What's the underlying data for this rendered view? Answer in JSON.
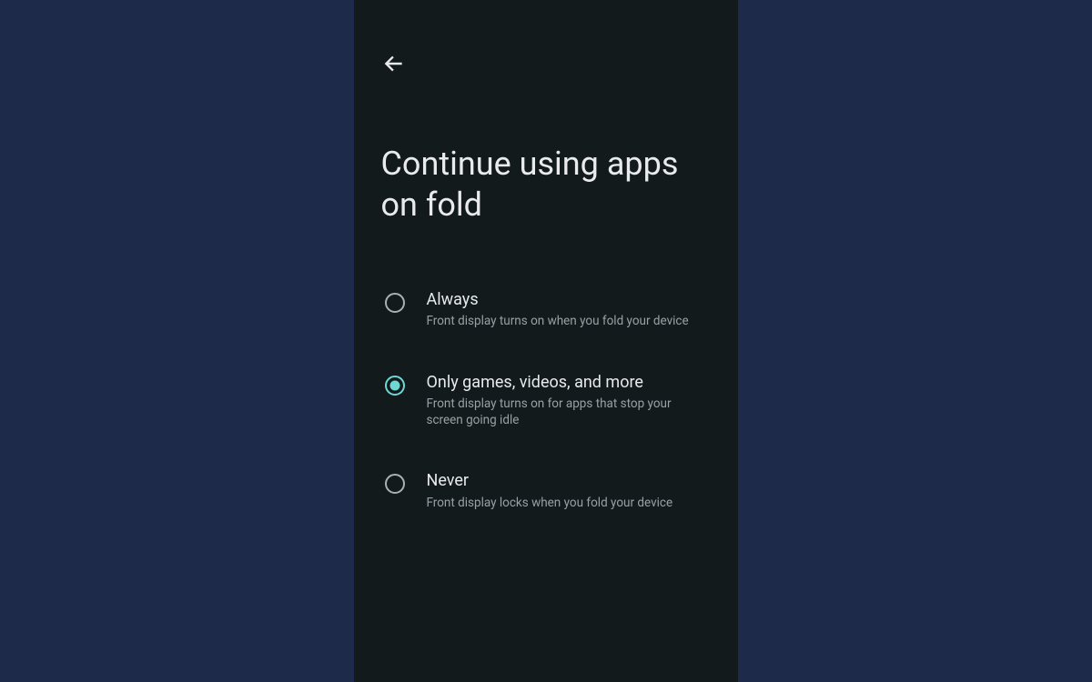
{
  "page": {
    "title": "Continue using apps on fold"
  },
  "options": [
    {
      "title": "Always",
      "description": "Front display turns on when you fold your device",
      "selected": false
    },
    {
      "title": "Only games, videos, and more",
      "description": "Front display turns on for apps that stop your screen going idle",
      "selected": true
    },
    {
      "title": "Never",
      "description": "Front display locks when you fold your device",
      "selected": false
    }
  ]
}
